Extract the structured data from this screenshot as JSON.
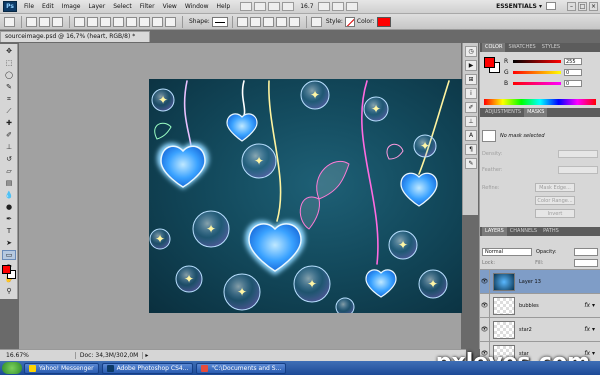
{
  "menubar": {
    "items": [
      "File",
      "Edit",
      "Image",
      "Layer",
      "Select",
      "Filter",
      "View",
      "Window",
      "Help"
    ],
    "zoom": "16.7",
    "workspace": "ESSENTIALS"
  },
  "options": {
    "shape_label": "Shape:",
    "style_label": "Style:",
    "color_label": "Color:",
    "color_value": "#ff0000"
  },
  "document": {
    "tab_title": "sourceimage.psd @ 16,7% (heart, RGB/8) *"
  },
  "status": {
    "zoom": "16.67%",
    "doc": "Doc: 34,3M/302,0M"
  },
  "panels": {
    "color_tabs": [
      "COLOR",
      "SWATCHES",
      "STYLES"
    ],
    "color_fg": "#ff0000",
    "rgb": [
      {
        "label": "R",
        "value": "255"
      },
      {
        "label": "G",
        "value": "0"
      },
      {
        "label": "B",
        "value": "0"
      }
    ],
    "adjust_tabs": [
      "ADJUSTMENTS",
      "MASKS"
    ],
    "mask_text": "No mask selected",
    "adjust_rows": [
      "Density:",
      "Feather:",
      "Refine:"
    ],
    "adjust_buttons": [
      "Mask Edge...",
      "Color Range...",
      "Invert"
    ],
    "layers_tabs": [
      "LAYERS",
      "CHANNELS",
      "PATHS"
    ],
    "blend_mode": "Normal",
    "opacity_label": "Opacity:",
    "lock_label": "Lock:",
    "fill_label": "Fill:",
    "layers": [
      {
        "name": "Layer 13",
        "selected": true,
        "fx": false
      },
      {
        "name": "bubbles",
        "selected": false,
        "fx": true
      },
      {
        "name": "star2",
        "selected": false,
        "fx": true
      },
      {
        "name": "star",
        "selected": false,
        "fx": true
      }
    ]
  },
  "taskbar": {
    "items": [
      "Yahoo! Messenger",
      "Adobe Photoshop CS4...",
      "\"C:\\Documents and S..."
    ]
  },
  "watermark": "pxleyes.com",
  "colors": {
    "accent": "#ff0000",
    "selection": "#7f9dc7",
    "taskbar": "#1d4a97"
  }
}
